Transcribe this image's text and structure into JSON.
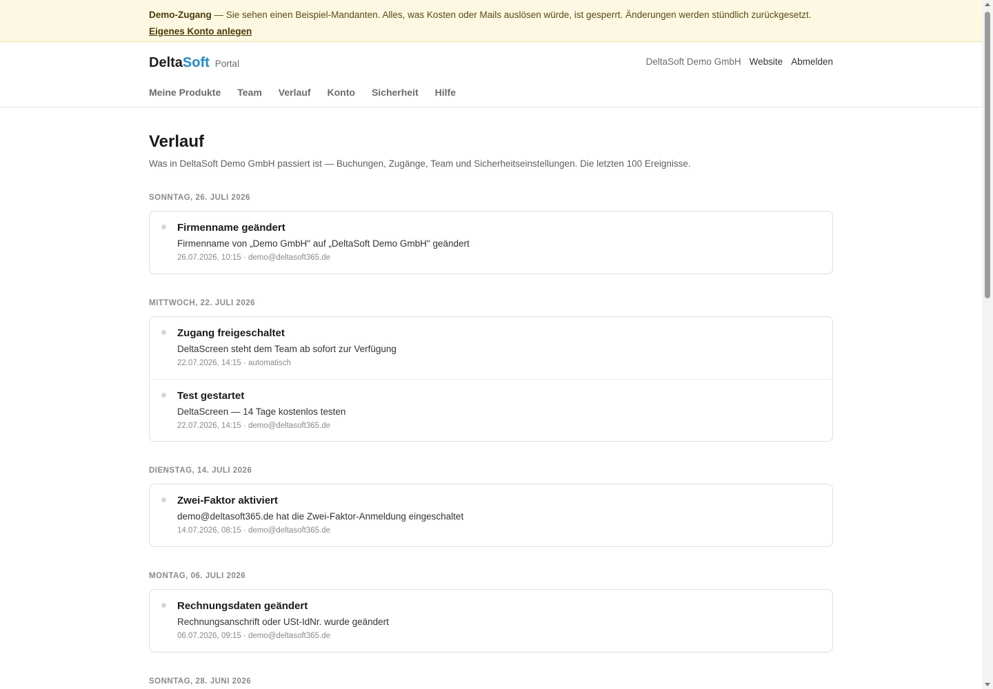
{
  "banner": {
    "label": "Demo-Zugang",
    "text": " — Sie sehen einen Beispiel-Mandanten. Alles, was Kosten oder Mails auslösen würde, ist gesperrt. Änderungen werden stündlich zurückgesetzt.",
    "link": "Eigenes Konto anlegen"
  },
  "header": {
    "brand_delta": "Delta",
    "brand_soft": "Soft",
    "brand_sub": "Portal",
    "company": "DeltaSoft Demo GmbH",
    "website": "Website",
    "logout": "Abmelden"
  },
  "nav": {
    "items": [
      "Meine Produkte",
      "Team",
      "Verlauf",
      "Konto",
      "Sicherheit",
      "Hilfe"
    ]
  },
  "page": {
    "title": "Verlauf",
    "subtitle": "Was in DeltaSoft Demo GmbH passiert ist — Buchungen, Zugänge, Team und Sicherheitseinstellungen. Die letzten 100 Ereignisse."
  },
  "groups": [
    {
      "date": "Sonntag, 26. Juli 2026",
      "entries": [
        {
          "title": "Firmenname geändert",
          "desc": "Firmenname von „Demo GmbH\" auf „DeltaSoft Demo GmbH\" geändert",
          "meta": "26.07.2026, 10:15 · demo@deltasoft365.de"
        }
      ]
    },
    {
      "date": "Mittwoch, 22. Juli 2026",
      "entries": [
        {
          "title": "Zugang freigeschaltet",
          "desc": "DeltaScreen steht dem Team ab sofort zur Verfügung",
          "meta": "22.07.2026, 14:15 · automatisch"
        },
        {
          "title": "Test gestartet",
          "desc": "DeltaScreen — 14 Tage kostenlos testen",
          "meta": "22.07.2026, 14:15 · demo@deltasoft365.de"
        }
      ]
    },
    {
      "date": "Dienstag, 14. Juli 2026",
      "entries": [
        {
          "title": "Zwei-Faktor aktiviert",
          "desc": "demo@deltasoft365.de hat die Zwei-Faktor-Anmeldung eingeschaltet",
          "meta": "14.07.2026, 08:15 · demo@deltasoft365.de"
        }
      ]
    },
    {
      "date": "Montag, 06. Juli 2026",
      "entries": [
        {
          "title": "Rechnungsdaten geändert",
          "desc": "Rechnungsanschrift oder USt-IdNr. wurde geändert",
          "meta": "06.07.2026, 09:15 · demo@deltasoft365.de"
        }
      ]
    },
    {
      "date": "Sonntag, 28. Juni 2026",
      "entries": []
    }
  ],
  "colors": {
    "accent": "#1a8fd6",
    "banner_bg": "#fdf8e1",
    "banner_text": "#5b4a12"
  }
}
